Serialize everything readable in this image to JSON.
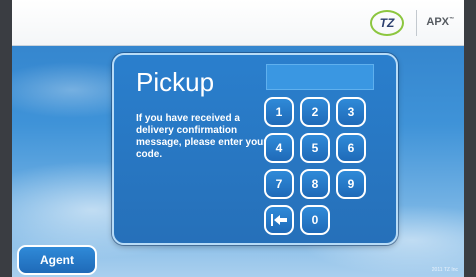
{
  "header": {
    "logo_text": "TZ",
    "brand_text": "APX",
    "brand_mark": "™"
  },
  "panel": {
    "title": "Pickup",
    "instructions": "If you have received a delivery confirmation message, please enter your code.",
    "code_value": ""
  },
  "keypad": {
    "keys": [
      "1",
      "2",
      "3",
      "4",
      "5",
      "6",
      "7",
      "8",
      "9",
      "0"
    ],
    "back_icon": "back-arrow-icon"
  },
  "agent_button": {
    "label": "Agent"
  },
  "footer": {
    "note": "2011 TZ Inc"
  },
  "colors": {
    "panel_blue": "#2a7fcd",
    "key_border": "#ffffff",
    "logo_green": "#8cc63f"
  }
}
